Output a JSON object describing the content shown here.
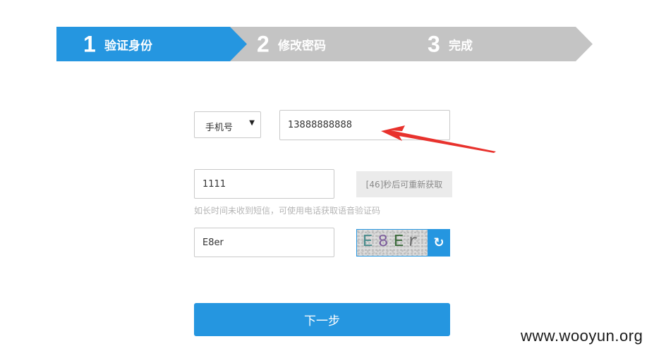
{
  "steps": [
    {
      "number": "1",
      "label": "验证身份",
      "state": "active"
    },
    {
      "number": "2",
      "label": "修改密码",
      "state": "inactive"
    },
    {
      "number": "3",
      "label": "完成",
      "state": "inactive"
    }
  ],
  "form": {
    "account_type": {
      "selected": "手机号",
      "caret_icon": "caret-down-icon"
    },
    "phone": {
      "value": "13888888888"
    },
    "sms_code": {
      "value": "1111"
    },
    "resend_button": {
      "label": "[46]秒后可重新获取"
    },
    "hint": "如长时间未收到短信，可使用电话获取语音验证码",
    "captcha_input": {
      "value": "E8er"
    },
    "captcha_image": {
      "chars": [
        "E",
        "8",
        "E",
        "r"
      ],
      "colors": [
        "#4a8c8c",
        "#7a5a9a",
        "#3a6a3a",
        "#6a6a6a"
      ]
    },
    "refresh_icon": "refresh-icon",
    "next_button": {
      "label": "下一步"
    }
  },
  "annotation": {
    "arrow_color": "#e8322d"
  },
  "watermark": "www.wooyun.org",
  "colors": {
    "accent": "#2596e0",
    "inactive_step": "#c4c4c4"
  }
}
